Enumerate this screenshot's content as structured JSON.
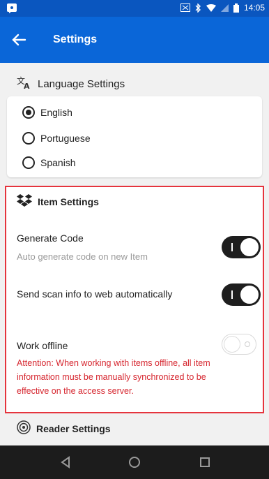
{
  "status_bar": {
    "time": "14:05"
  },
  "app_bar": {
    "title": "Settings"
  },
  "language_section": {
    "header": "Language Settings",
    "options": [
      {
        "label": "English",
        "selected": true
      },
      {
        "label": "Portuguese",
        "selected": false
      },
      {
        "label": "Spanish",
        "selected": false
      }
    ]
  },
  "item_section": {
    "header": "Item Settings",
    "generate_code": {
      "label": "Generate Code",
      "description": "Auto generate code on new Item",
      "on": true
    },
    "send_scan": {
      "label": "Send scan info to web automatically",
      "on": true
    },
    "work_offline": {
      "label": "Work offline",
      "on": false,
      "warning": "Attention: When working with items offline, all item information must be manually synchronized to be effective on the access server."
    }
  },
  "reader_section": {
    "header": "Reader Settings"
  },
  "colors": {
    "app_bar": "#0a66d8",
    "status_bar": "#0a56bf",
    "highlight": "#e5343d",
    "warning": "#d6262f"
  }
}
